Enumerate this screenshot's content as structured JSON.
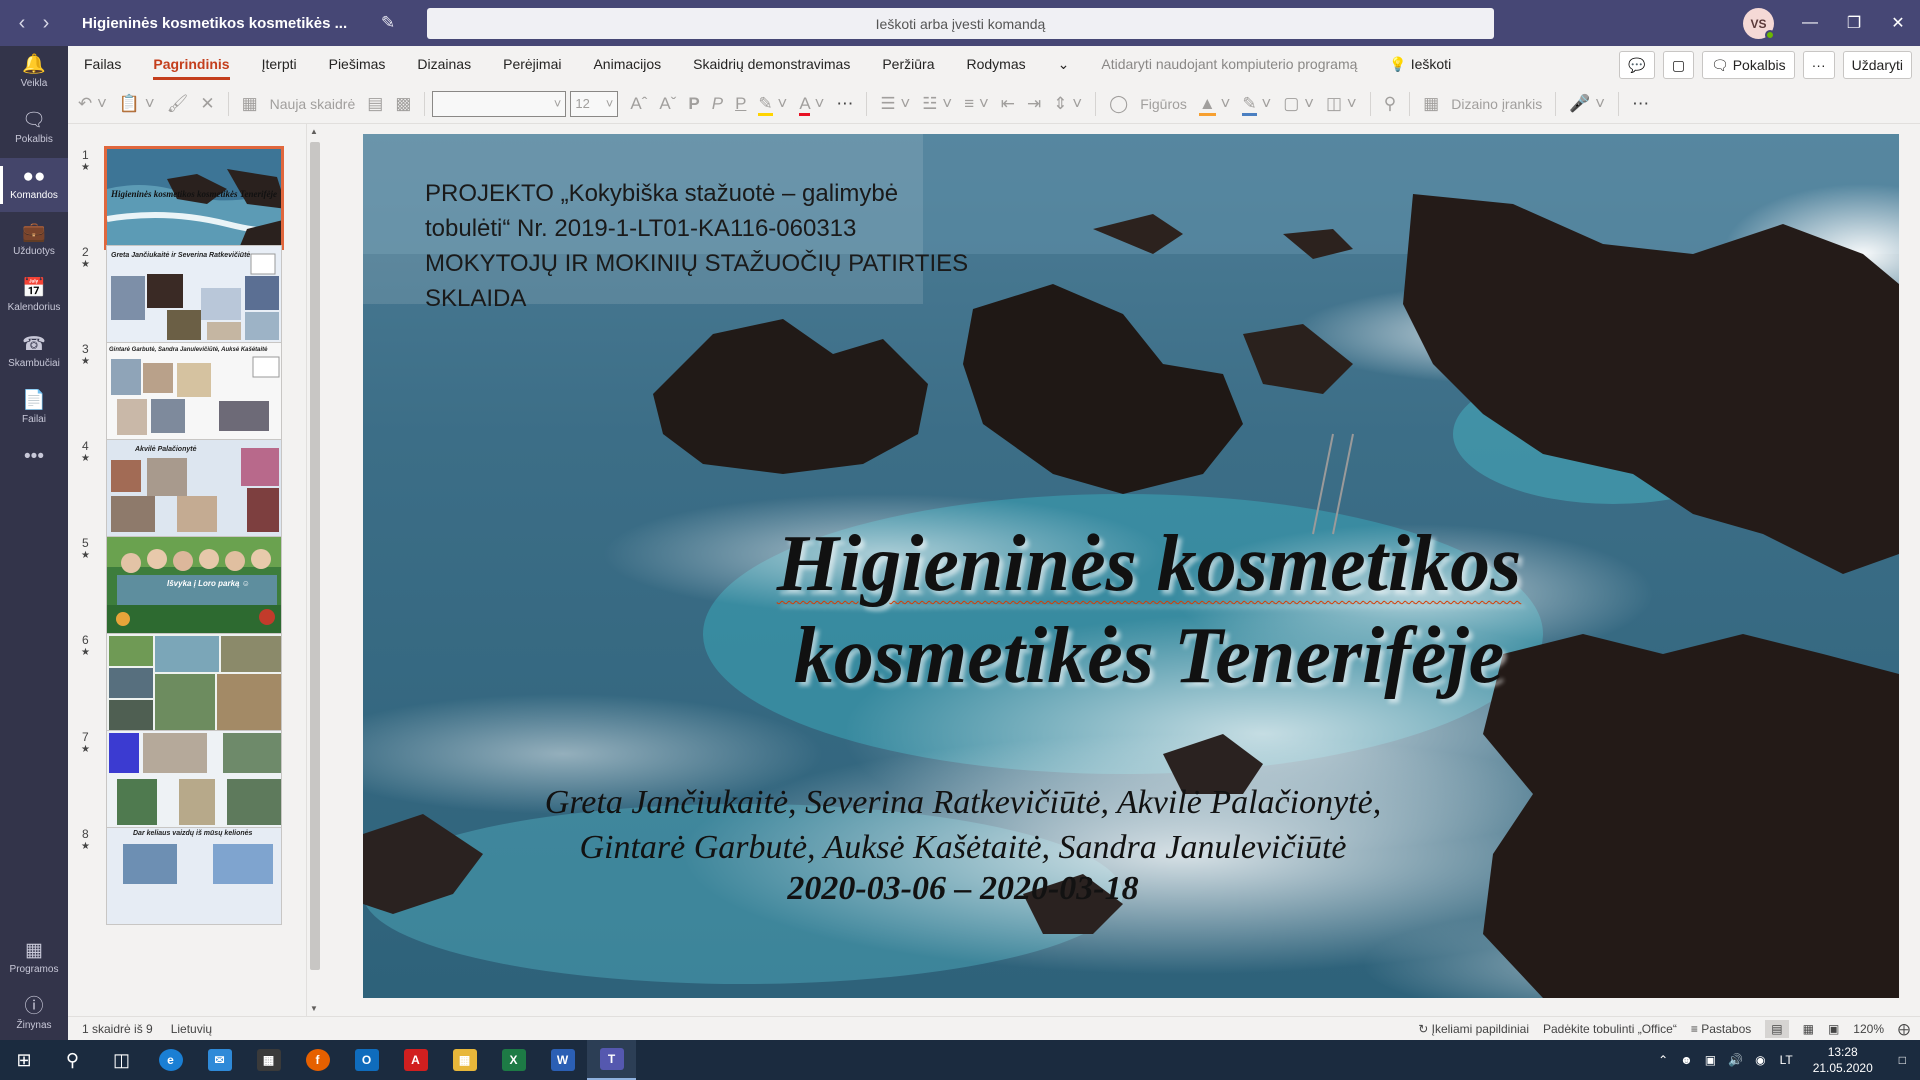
{
  "titlebar": {
    "back": "‹",
    "forward": "›",
    "title": "Higieninės kosmetikos kosmetikės ...",
    "search_placeholder": "Ieškoti arba įvesti komandą",
    "avatar": "VS"
  },
  "rail": {
    "items": [
      {
        "label": "Veikla",
        "icon": "bell-icon"
      },
      {
        "label": "Pokalbis",
        "icon": "chat-icon"
      },
      {
        "label": "Komandos",
        "icon": "teams-icon"
      },
      {
        "label": "Užduotys",
        "icon": "assignments-icon"
      },
      {
        "label": "Kalendorius",
        "icon": "calendar-icon"
      },
      {
        "label": "Skambučiai",
        "icon": "phone-icon"
      },
      {
        "label": "Failai",
        "icon": "file-icon"
      }
    ],
    "more": "•••",
    "bottom": [
      {
        "label": "Programos",
        "icon": "apps-icon"
      },
      {
        "label": "Žinynas",
        "icon": "help-icon"
      }
    ]
  },
  "ribbon": {
    "tabs": [
      "Failas",
      "Pagrindinis",
      "Įterpti",
      "Piešimas",
      "Dizainas",
      "Perėjimai",
      "Animacijos",
      "Skaidrių demonstravimas",
      "Peržiūra",
      "Rodymas"
    ],
    "more_chevron": "⌄",
    "open_desktop": "Atidaryti naudojant kompiuterio programą",
    "search": "Ieškoti",
    "chat": "Pokalbis",
    "ellipsis": "···",
    "close": "Uždaryti"
  },
  "toolbar": {
    "new_slide": "Nauja skaidrė",
    "font_size": "12",
    "bold": "P",
    "italic": "P",
    "underline": "P",
    "shapes": "Figūros",
    "designer": "Dizaino įrankis"
  },
  "thumbnails": {
    "items": [
      {
        "num": "1",
        "caption": "Higieninės kosmetikos kosmetikės Tenerifėje"
      },
      {
        "num": "2",
        "caption": "Greta Jančiukaitė ir Severina Ratkevičiūtė"
      },
      {
        "num": "3",
        "caption": "Gintarė Garbutė, Sandra Janulevičiūtė, Auksė Kašėtaitė"
      },
      {
        "num": "4",
        "caption": "Akvilė Palačionytė"
      },
      {
        "num": "5",
        "caption": "Išvyka į Loro parką ☺"
      },
      {
        "num": "6",
        "caption": ""
      },
      {
        "num": "7",
        "caption": ""
      },
      {
        "num": "8",
        "caption": "Dar keliaus vaizdų iš mūsų kelionės"
      }
    ]
  },
  "slide": {
    "project_lines": [
      "PROJEKTO „Kokybiška stažuotė – galimybė",
      "tobulėti“ Nr. 2019-1-LT01-KA116-060313",
      "MOKYTOJŲ IR MOKINIŲ STAŽUOČIŲ PATIRTIES",
      "SKLAIDA"
    ],
    "title_line1": "Higieninės kosmetikos",
    "title_line2": "kosmetikės Tenerifėje",
    "authors_line1": "Greta Jančiukaitė, Severina Ratkevičiūtė, Akvilė Palačionytė,",
    "authors_line2": "Gintarė Garbutė, Auksė Kašėtaitė, Sandra Janulevičiūtė",
    "dates": "2020-03-06 – 2020-03-18"
  },
  "statusbar": {
    "slide_count": "1 skaidrė iš 9",
    "language": "Lietuvių",
    "addins": "Įkeliami papildiniai",
    "office_help": "Padėkite tobulinti „Office“",
    "notes": "Pastabos",
    "zoom": "120%"
  },
  "taskbar": {
    "language": "LT",
    "time": "13:28",
    "date": "21.05.2020"
  }
}
